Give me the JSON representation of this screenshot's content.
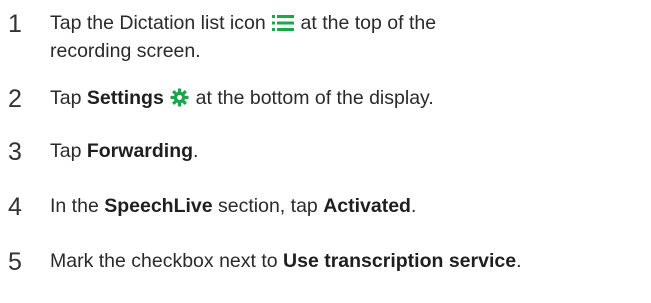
{
  "colors": {
    "accent": "#1aa64a",
    "text": "#2a2a2a"
  },
  "steps": [
    {
      "number": "1",
      "line1_before": "Tap the Dictation list icon",
      "icon": "list-icon",
      "line1_after": "at the top of the",
      "line2": "recording screen."
    },
    {
      "number": "2",
      "before": "Tap ",
      "bold": "Settings",
      "icon": "gear-icon",
      "after": "at the bottom of the display."
    },
    {
      "number": "3",
      "before": "Tap ",
      "bold": "Forwarding",
      "after": "."
    },
    {
      "number": "4",
      "before": "In the ",
      "bold1": "SpeechLive",
      "middle": " section, tap ",
      "bold2": "Activated",
      "after": "."
    },
    {
      "number": "5",
      "before": "Mark the checkbox next to ",
      "bold": "Use transcription service",
      "after": "."
    }
  ]
}
